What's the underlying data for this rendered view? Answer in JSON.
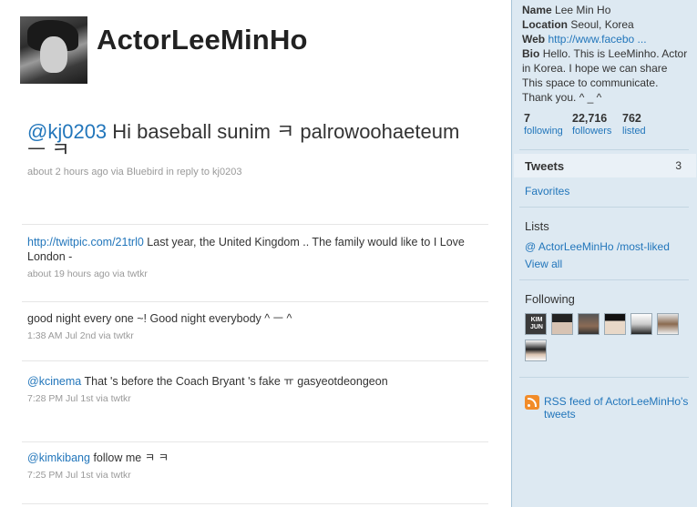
{
  "profile_header": {
    "screen_name": "ActorLeeMinHo"
  },
  "featured_tweet": {
    "mention": "@kj0203",
    "text": " Hi baseball sunim ㅋ palrowoohaeteum ㅡ ㅋ",
    "meta": "about 2 hours ago via Bluebird in reply to kj0203"
  },
  "timeline": [
    {
      "link": "http://twitpic.com/21trl0",
      "text": " Last year, the United Kingdom .. The family would like to I Love London -",
      "meta": "about 19 hours ago via twtkr"
    },
    {
      "link": "",
      "text": "good night every one ~! Good night everybody ^ ㅡ ^",
      "meta": "1:38 AM Jul 2nd via twtkr"
    },
    {
      "link": "@kcinema",
      "text": " That 's before the Coach Bryant 's fake ㅠ gasyeotdeongeon",
      "meta": "7:28 PM Jul 1st via twtkr"
    },
    {
      "link": "@kimkibang",
      "text": " follow me ㅋ ㅋ",
      "meta": "7:25 PM Jul 1st via twtkr"
    }
  ],
  "sidebar": {
    "name_label": "Name",
    "name_value": "Lee Min Ho",
    "location_label": "Location",
    "location_value": "Seoul, Korea",
    "web_label": "Web",
    "web_value": "http://www.facebo ...",
    "bio_label": "Bio",
    "bio_value": "Hello. This is LeeMinho. Actor in Korea. I hope we can share This space to communicate. Thank you. ^ _ ^",
    "stats": [
      {
        "num": "7",
        "label": "following"
      },
      {
        "num": "22,716",
        "label": "followers"
      },
      {
        "num": "762",
        "label": "listed"
      }
    ],
    "tweets_label": "Tweets",
    "tweets_count": "3",
    "favorites_label": "Favorites",
    "lists_heading": "Lists",
    "list_link": "@ ActorLeeMinHo /most-liked",
    "view_all": "View all",
    "following_heading": "Following",
    "following_avatars": [
      {
        "name": "following-avatar-kimjun",
        "caption": "KIM JUN",
        "bg": "#3a3a3a"
      },
      {
        "name": "following-avatar-2",
        "caption": "",
        "bg": "#6b6b6b"
      },
      {
        "name": "following-avatar-3",
        "caption": "",
        "bg": "#4d4d4d"
      },
      {
        "name": "following-avatar-4",
        "caption": "",
        "bg": "#b5b5b5"
      },
      {
        "name": "following-avatar-5",
        "caption": "",
        "bg": "#2b2b2b"
      },
      {
        "name": "following-avatar-6",
        "caption": "",
        "bg": "#8f8f8f"
      },
      {
        "name": "following-avatar-7",
        "caption": "",
        "bg": "#c9c9c9"
      }
    ],
    "rss_text": "RSS feed of ActorLeeMinHo's tweets"
  },
  "colors": {
    "link": "#2276bb",
    "sidebar_bg": "#dde9f2",
    "rss": "#f28c29"
  }
}
